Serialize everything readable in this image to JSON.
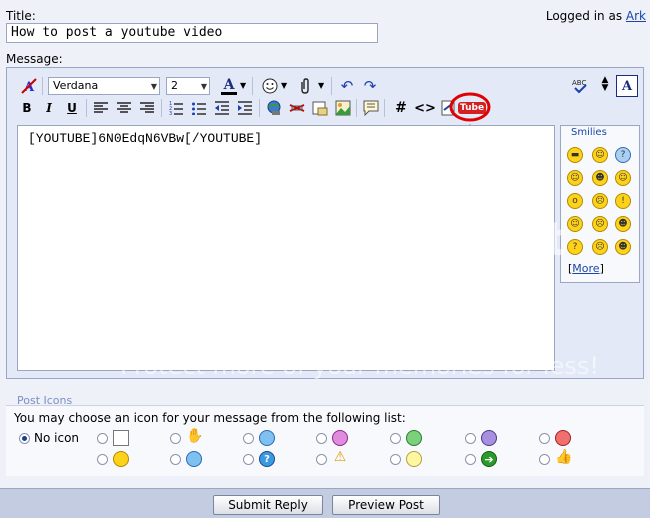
{
  "header": {
    "title_label": "Title:",
    "title_value": "How to post a youtube video",
    "logged_in_prefix": "Logged in as",
    "username": "Ark",
    "message_label": "Message:"
  },
  "toolbar": {
    "font_value": "Verdana",
    "size_value": "2",
    "bold": "B",
    "italic": "I",
    "underline": "U",
    "hash": "#",
    "code": "<>",
    "youtube": "Tube",
    "font_color_letter": "A",
    "resize_glyph": "A"
  },
  "editor": {
    "content": "[YOUTUBE]6N0EdqN6VBw[/YOUTUBE]"
  },
  "smilies": {
    "title": "Smilies",
    "more_open": "[",
    "more_link": "More",
    "more_close": "]"
  },
  "post_icons": {
    "title": "Post Icons",
    "instructions": "You may choose an icon for your message from the following list:",
    "no_icon_label": "No icon"
  },
  "buttons": {
    "submit": "Submit Reply",
    "preview": "Preview Post"
  },
  "colors": {
    "annotation_red": "#e00000",
    "link_blue": "#1a46a8"
  }
}
